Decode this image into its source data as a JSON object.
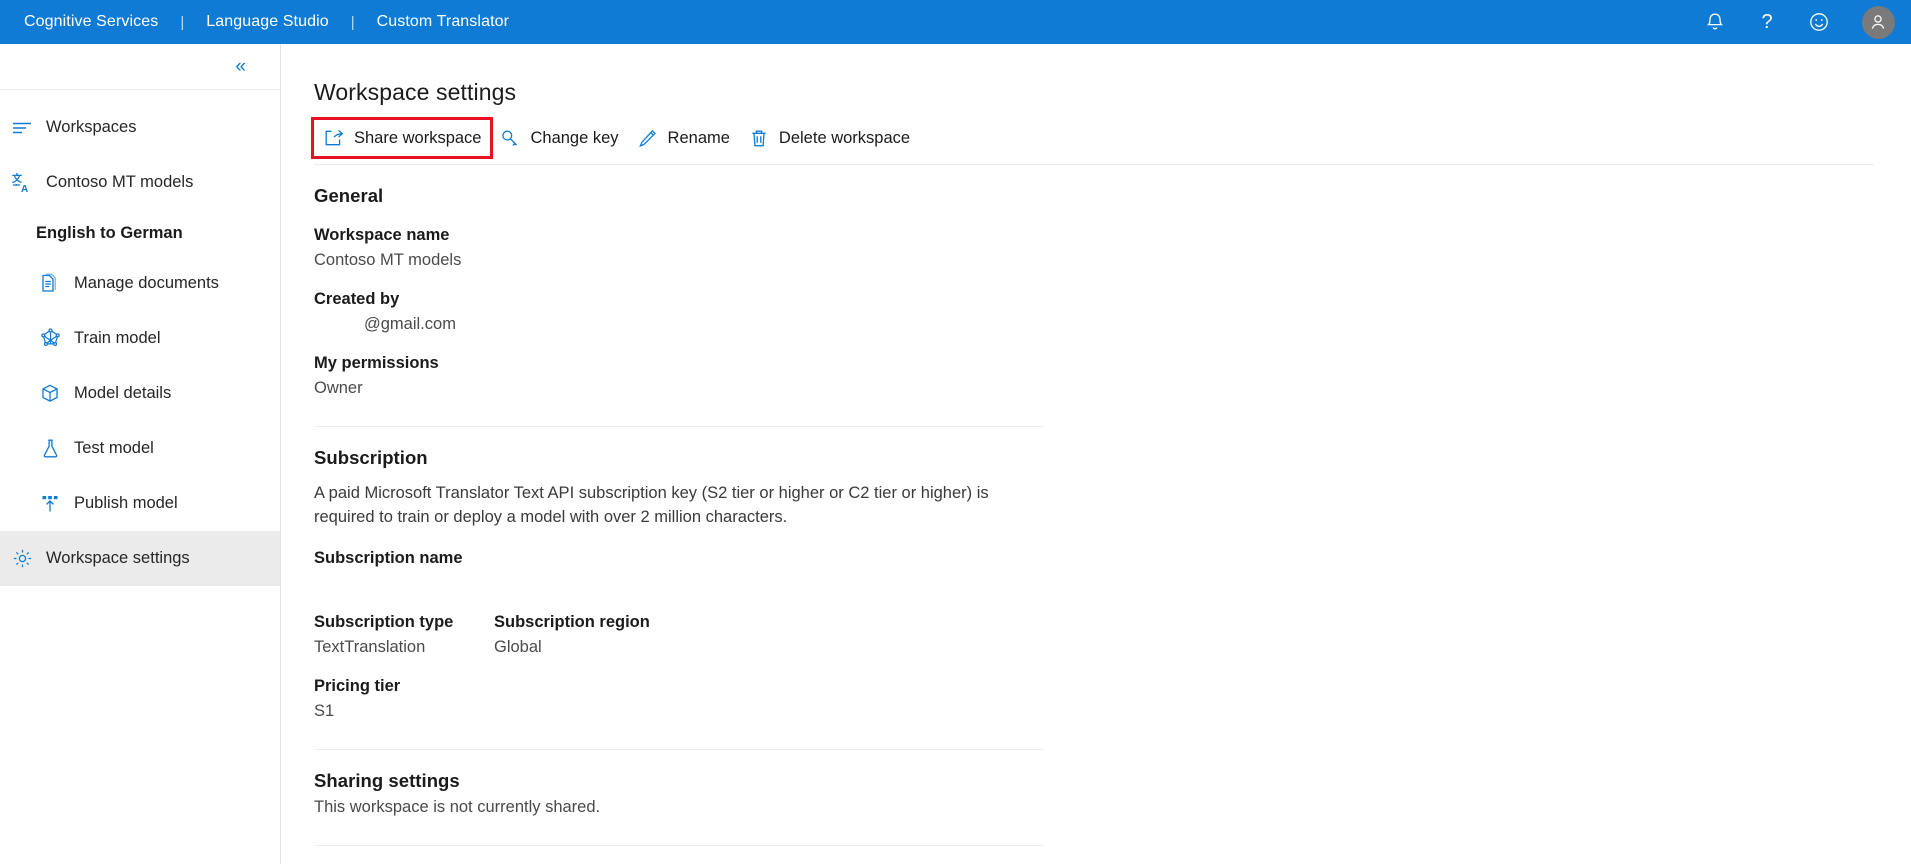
{
  "topbar": {
    "links": [
      {
        "label": "Cognitive Services",
        "name": "cognitive-services-link"
      },
      {
        "label": "Language Studio",
        "name": "language-studio-link"
      },
      {
        "label": "Custom Translator",
        "name": "custom-translator-link"
      }
    ],
    "separator": "|",
    "icons": [
      {
        "name": "notification-bell-icon",
        "label": "Notifications"
      },
      {
        "name": "help-question-icon",
        "label": "Help"
      },
      {
        "name": "feedback-smiley-icon",
        "label": "Feedback"
      },
      {
        "name": "user-avatar-icon",
        "label": "Account"
      }
    ],
    "background_color": "#0f7bd4"
  },
  "sidebar": {
    "collapse_label": "«",
    "items": [
      {
        "label": "Workspaces",
        "icon": "list-lines-icon",
        "selected": false,
        "bold": false,
        "indent": false
      },
      {
        "label": "Contoso MT models",
        "icon": "translate-icon",
        "selected": false,
        "bold": false,
        "indent": false
      },
      {
        "label": "English to German",
        "icon": "",
        "selected": false,
        "bold": true,
        "indent": true
      },
      {
        "label": "Manage documents",
        "icon": "documents-icon",
        "selected": false,
        "bold": false,
        "indent": true
      },
      {
        "label": "Train model",
        "icon": "train-network-icon",
        "selected": false,
        "bold": false,
        "indent": true
      },
      {
        "label": "Model details",
        "icon": "cube-box-icon",
        "selected": false,
        "bold": false,
        "indent": true
      },
      {
        "label": "Test model",
        "icon": "flask-icon",
        "selected": false,
        "bold": false,
        "indent": true
      },
      {
        "label": "Publish model",
        "icon": "publish-upload-icon",
        "selected": false,
        "bold": false,
        "indent": true
      },
      {
        "label": "Workspace settings",
        "icon": "gear-icon",
        "selected": true,
        "bold": false,
        "indent": false
      }
    ],
    "selected_background": "#ebebeb"
  },
  "main": {
    "page_title": "Workspace settings",
    "commands": [
      {
        "label": "Share workspace",
        "icon": "share-icon",
        "name": "share-workspace-button",
        "highlighted": true
      },
      {
        "label": "Change key",
        "icon": "key-icon",
        "name": "change-key-button",
        "highlighted": false
      },
      {
        "label": "Rename",
        "icon": "pencil-edit-icon",
        "name": "rename-button",
        "highlighted": false
      },
      {
        "label": "Delete workspace",
        "icon": "trash-delete-icon",
        "name": "delete-workspace-button",
        "highlighted": false
      }
    ],
    "highlight_color": "#e81123",
    "general": {
      "section_title": "General",
      "workspace_name_label": "Workspace name",
      "workspace_name_value": "Contoso MT models",
      "created_by_label": "Created by",
      "created_by_value": "@gmail.com",
      "my_permissions_label": "My permissions",
      "my_permissions_value": "Owner"
    },
    "subscription": {
      "section_title": "Subscription",
      "description": "A paid Microsoft Translator Text API subscription key (S2 tier or higher or C2 tier or higher) is required to train or deploy a model with over 2 million characters.",
      "subscription_name_label": "Subscription name",
      "subscription_name_value": "",
      "subscription_type_label": "Subscription type",
      "subscription_type_value": "TextTranslation",
      "subscription_region_label": "Subscription region",
      "subscription_region_value": "Global",
      "pricing_tier_label": "Pricing tier",
      "pricing_tier_value": "S1"
    },
    "sharing": {
      "section_title": "Sharing settings",
      "status_text": "This workspace is not currently shared."
    }
  }
}
